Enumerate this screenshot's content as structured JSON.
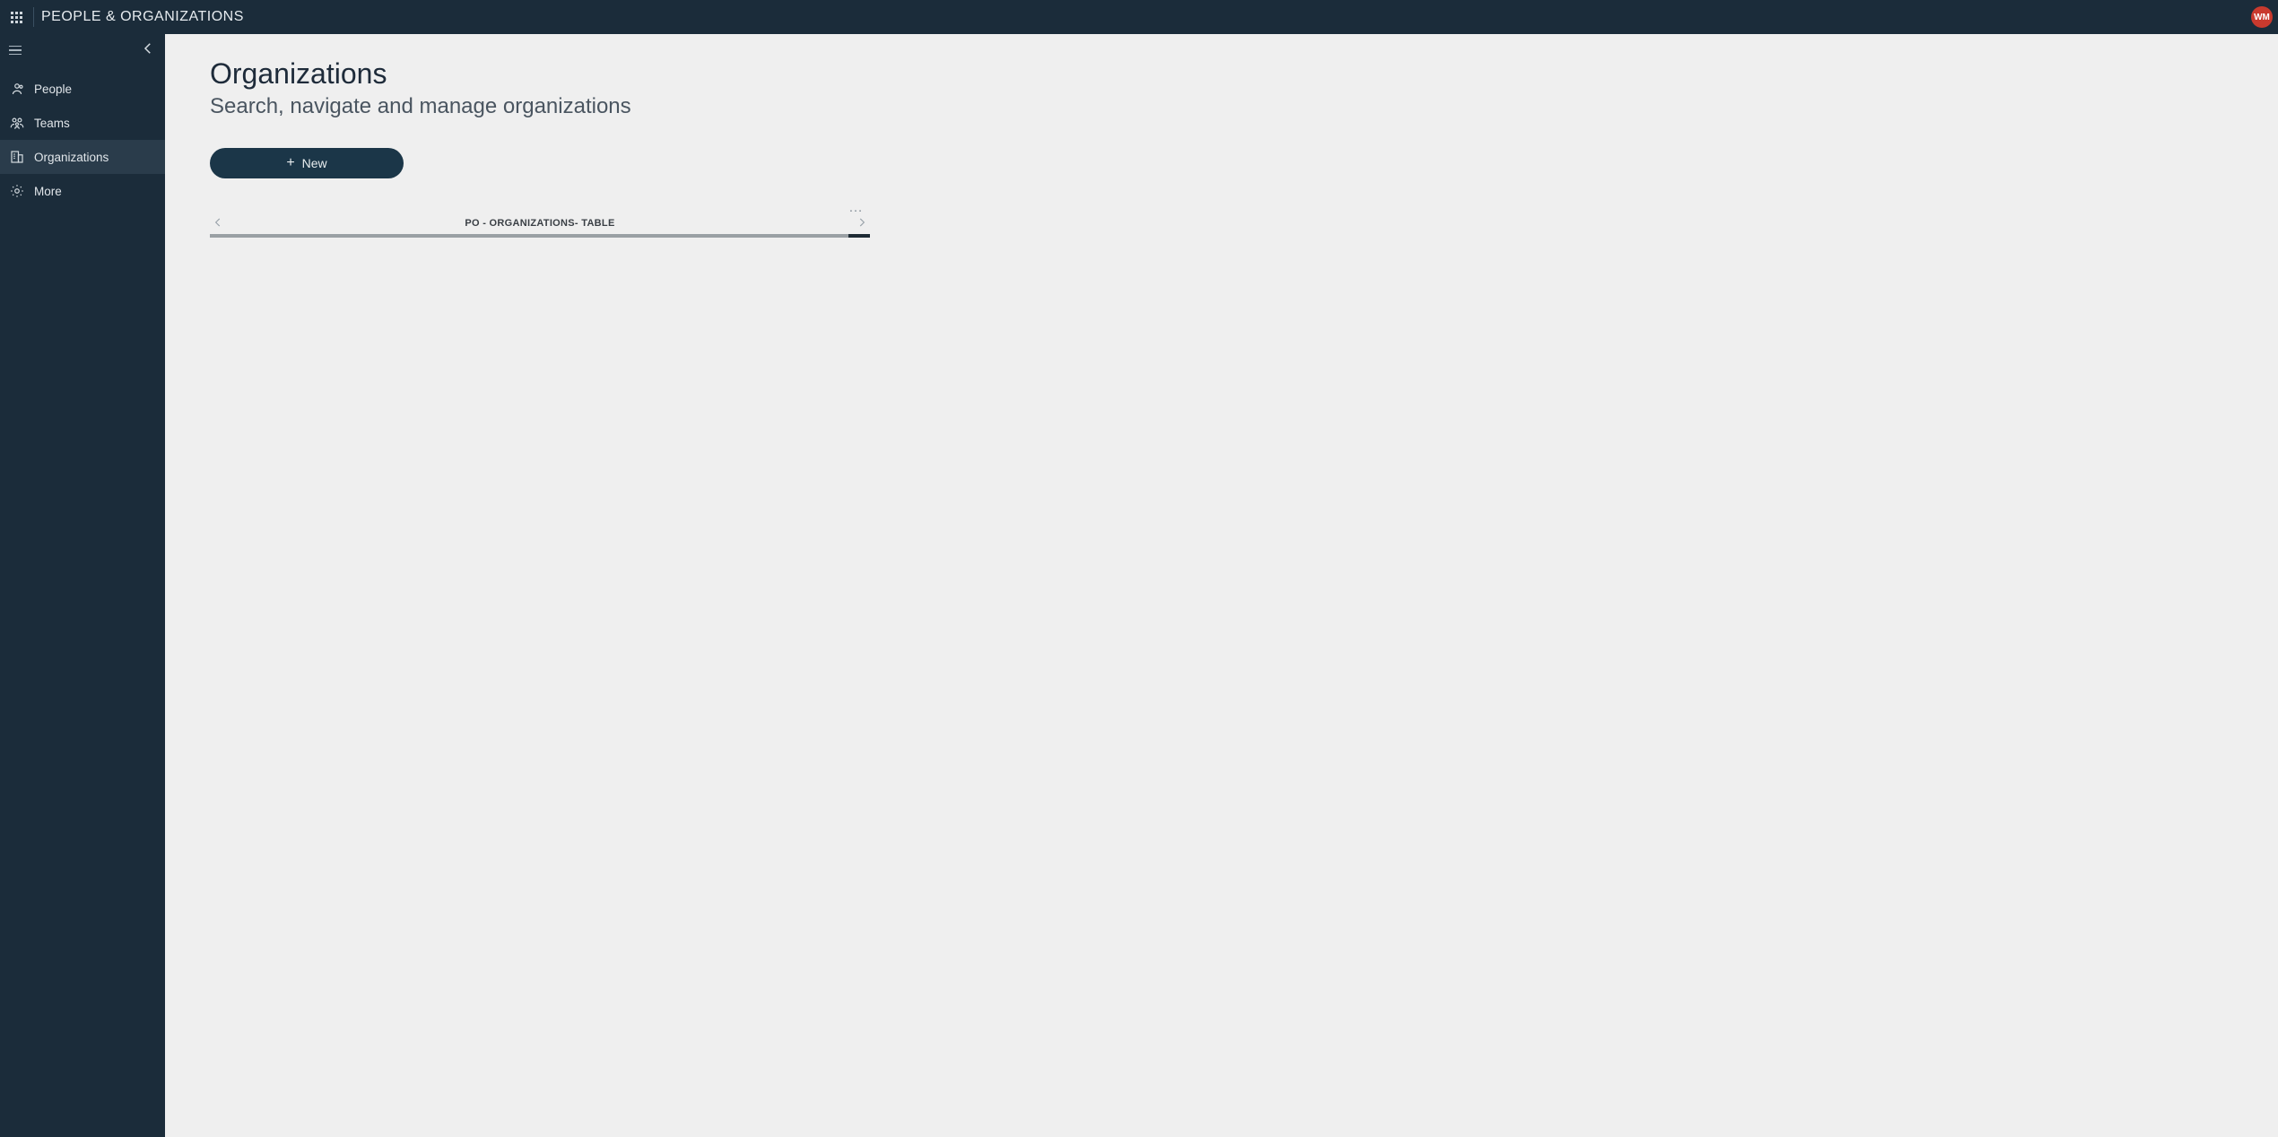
{
  "header": {
    "app_title": "PEOPLE & ORGANIZATIONS",
    "avatar_initials": "WM"
  },
  "sidebar": {
    "items": [
      {
        "icon": "people-icon",
        "label": "People",
        "active": false
      },
      {
        "icon": "teams-icon",
        "label": "Teams",
        "active": false
      },
      {
        "icon": "organizations-icon",
        "label": "Organizations",
        "active": true
      },
      {
        "icon": "gear-icon",
        "label": "More",
        "active": false
      }
    ]
  },
  "main": {
    "title": "Organizations",
    "subtitle": "Search, navigate and manage organizations",
    "new_button_label": "New",
    "tabs": {
      "more_icon": "…",
      "active_label": "PO - ORGANIZATIONS- TABLE"
    }
  }
}
